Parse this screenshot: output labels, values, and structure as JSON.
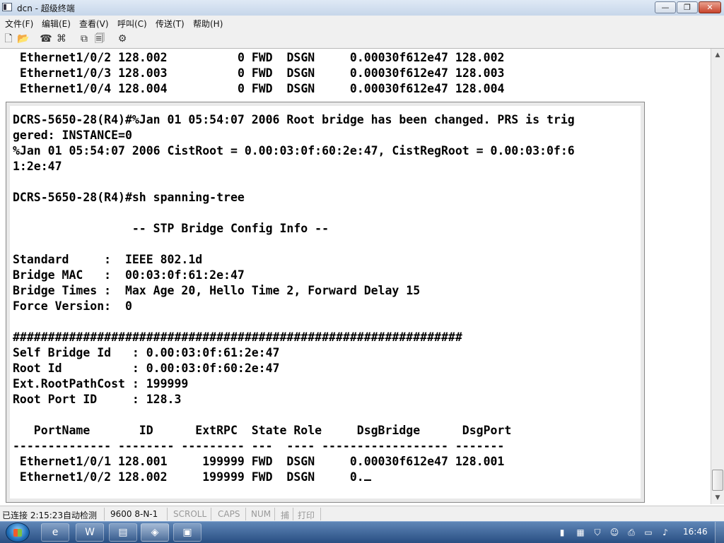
{
  "window": {
    "title": "dcn - 超级终端",
    "controls": {
      "minimize": "—",
      "maximize": "❐",
      "close": "✕"
    }
  },
  "menu": {
    "items": [
      "文件(F)",
      "编辑(E)",
      "查看(V)",
      "呼叫(C)",
      "传送(T)",
      "帮助(H)"
    ]
  },
  "toolbar": {
    "icons": [
      "new-file-icon",
      "open-folder-icon",
      "phone-icon",
      "disconnect-icon",
      "send-icon",
      "receive-icon",
      "properties-icon"
    ]
  },
  "terminal": {
    "top_lines": [
      "Ethernet1/0/2 128.002          0 FWD  DSGN     0.00030f612e47 128.002",
      "Ethernet1/0/3 128.003          0 FWD  DSGN     0.00030f612e47 128.003",
      "Ethernet1/0/4 128.004          0 FWD  DSGN     0.00030f612e47 128.004"
    ],
    "lines": [
      "DCRS-5650-28(R4)#%Jan 01 05:54:07 2006 Root bridge has been changed. PRS is trig",
      "gered: INSTANCE=0",
      "%Jan 01 05:54:07 2006 CistRoot = 0.00:03:0f:60:2e:47, CistRegRoot = 0.00:03:0f:6",
      "1:2e:47",
      "",
      "DCRS-5650-28(R4)#sh spanning-tree",
      "",
      "                 -- STP Bridge Config Info --",
      "",
      "Standard     :  IEEE 802.1d",
      "Bridge MAC   :  00:03:0f:61:2e:47",
      "Bridge Times :  Max Age 20, Hello Time 2, Forward Delay 15",
      "Force Version:  0",
      "",
      "################################################################",
      "Self Bridge Id   : 0.00:03:0f:61:2e:47",
      "Root Id          : 0.00:03:0f:60:2e:47",
      "Ext.RootPathCost : 199999",
      "Root Port ID     : 128.3",
      "",
      "   PortName       ID      ExtRPC  State Role     DsgBridge      DsgPort",
      "-------------- -------- --------- ---  ---- ------------------ -------",
      " Ethernet1/0/1 128.001     199999 FWD  DSGN     0.00030f612e47 128.001",
      " Ethernet1/0/2 128.002     199999 FWD  DSGN     0."
    ]
  },
  "statusbar": {
    "connection": "已连接 2:15:23",
    "detect": "自动检测",
    "baud": "9600 8-N-1",
    "scroll": "SCROLL",
    "caps": "CAPS",
    "num": "NUM",
    "capture": "捕",
    "print": "打印"
  },
  "taskbar": {
    "clock": "16:46",
    "buttons": [
      "ie-icon",
      "word-icon",
      "explorer-icon",
      "network-icon",
      "presentation-icon"
    ],
    "tray": [
      "action-center-icon",
      "network-tray-icon",
      "shield-icon",
      "people-icon",
      "printer-icon",
      "device-icon",
      "volume-icon"
    ]
  }
}
